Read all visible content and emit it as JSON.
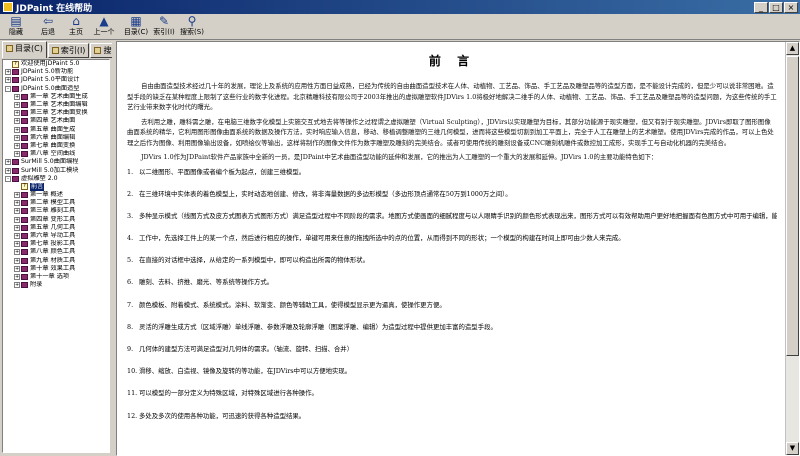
{
  "window": {
    "title": "JDPaint 在线帮助",
    "min": "_",
    "max": "□",
    "close": "×"
  },
  "toolbar": [
    {
      "name": "hide",
      "label": "隐藏",
      "icon": "▤"
    },
    {
      "name": "back",
      "label": "后退",
      "icon": "⇦"
    },
    {
      "name": "home",
      "label": "主页",
      "icon": "⌂"
    },
    {
      "name": "prev",
      "label": "上一个",
      "icon": "▲"
    },
    {
      "name": "toc",
      "label": "目录(C)",
      "icon": "▦"
    },
    {
      "name": "index",
      "label": "索引(I)",
      "icon": "✎"
    },
    {
      "name": "search",
      "label": "搜索(S)",
      "icon": "⚲"
    }
  ],
  "tabs": [
    {
      "label": "目录(C)",
      "active": true
    },
    {
      "label": "索引(I)",
      "active": false
    },
    {
      "label": "搜索(S)",
      "active": false
    }
  ],
  "tree": [
    {
      "indent": 0,
      "exp": "",
      "icon": "q",
      "text": "欢迎使用JDPaint 5.0"
    },
    {
      "indent": 0,
      "exp": "+",
      "icon": "bk",
      "text": "JDPaint 5.0新功能"
    },
    {
      "indent": 0,
      "exp": "+",
      "icon": "bk",
      "text": "JDPaint 5.0平面设计"
    },
    {
      "indent": 0,
      "exp": "-",
      "icon": "bk",
      "text": "JDPaint 5.0曲面造型"
    },
    {
      "indent": 1,
      "exp": "+",
      "icon": "bk",
      "text": "第一章 艺术曲面生成"
    },
    {
      "indent": 1,
      "exp": "+",
      "icon": "bk",
      "text": "第二章 艺术曲面编辑"
    },
    {
      "indent": 1,
      "exp": "+",
      "icon": "bk",
      "text": "第三章 艺术曲面变换"
    },
    {
      "indent": 1,
      "exp": "+",
      "icon": "bk",
      "text": "第四章 艺术曲面"
    },
    {
      "indent": 1,
      "exp": "+",
      "icon": "bk",
      "text": "第五章 曲面生成"
    },
    {
      "indent": 1,
      "exp": "+",
      "icon": "bk",
      "text": "第六章 曲面编辑"
    },
    {
      "indent": 1,
      "exp": "+",
      "icon": "bk",
      "text": "第七章 曲面变换"
    },
    {
      "indent": 1,
      "exp": "+",
      "icon": "bk",
      "text": "第八章 空间曲线"
    },
    {
      "indent": 0,
      "exp": "+",
      "icon": "bk",
      "text": "SurMill 5.0曲面编程"
    },
    {
      "indent": 0,
      "exp": "+",
      "icon": "bk",
      "text": "SurMill 5.0加工模块"
    },
    {
      "indent": 0,
      "exp": "-",
      "icon": "bk",
      "text": "虚拟雕塑 2.0"
    },
    {
      "indent": 1,
      "exp": "",
      "icon": "q",
      "text": "前言",
      "selected": true
    },
    {
      "indent": 1,
      "exp": "+",
      "icon": "bk",
      "text": "第一章 概述"
    },
    {
      "indent": 1,
      "exp": "+",
      "icon": "bk",
      "text": "第二章 模型工具"
    },
    {
      "indent": 1,
      "exp": "+",
      "icon": "bk",
      "text": "第三章 雕刻工具"
    },
    {
      "indent": 1,
      "exp": "+",
      "icon": "bk",
      "text": "第四章 变形工具"
    },
    {
      "indent": 1,
      "exp": "+",
      "icon": "bk",
      "text": "第五章 几何工具"
    },
    {
      "indent": 1,
      "exp": "+",
      "icon": "bk",
      "text": "第六章 导动工具"
    },
    {
      "indent": 1,
      "exp": "+",
      "icon": "bk",
      "text": "第七章 投影工具"
    },
    {
      "indent": 1,
      "exp": "+",
      "icon": "bk",
      "text": "第八章 颜色工具"
    },
    {
      "indent": 1,
      "exp": "+",
      "icon": "bk",
      "text": "第九章 材质工具"
    },
    {
      "indent": 1,
      "exp": "+",
      "icon": "bk",
      "text": "第十章 效果工具"
    },
    {
      "indent": 1,
      "exp": "+",
      "icon": "bk",
      "text": "第十一章 选项"
    },
    {
      "indent": 1,
      "exp": "+",
      "icon": "bk",
      "text": "附录"
    }
  ],
  "doc": {
    "title": "前 言",
    "paragraphs": [
      "自由曲面造型技术经过几十年的发展，理论上及系统的应用性方面日益成熟，已经为传统的自由曲面造型技术在人体、动植物、工艺品、饰品、手工艺品及雕塑品等的造型方面，是不能设计完成的，但是少可以说非常困难。造型手段的缺乏在某种程度上限制了这些行业的数字化进程。北京精雕科技有限公司于2003年推出的虚拟雕塑软件JDVirs 1.0将极好地解决二维手的人体、动植物、工艺品、饰品、手工艺品及雕塑品等的造型问题，为这些传统的手工艺行业带来数字化时代的曙光。",
      "去利用之雕，雕科需之雕，在电脑三维数字化模型上实施交互式地去将等操作之过程谓之虚拟雕塑（Virtual Sculpting），JDVirs以实现雕塑为目标，其部分功能源于现实雕塑，但又有别于现实雕塑。JDVirs即取了图形图像曲面系统的精华，它利用图形图像曲面系统的数据及操作方法，实时响应输入信息，移动、移植调整雕塑的三维几何模型，进而将这些模型切割到加工平面上，完全于人工在雕塑上的艺术雕塑。使用JDVirs完成的作品，可以上色处理之后作为图像、利用图像输出设备，如喷绘仪等输出，这样将制作的图像文件作为数字雕塑及雕刻的完美结合。或者可使用传统的雕刻设备或CNC雕刻机雕件或数控加工成形，实现手工与自动化机器的完美结合。",
      "JDVirs 1.0作为JDPaint软件产品家族中全新的一员，是JDPaint中艺术曲面造型功能的延伸和发展，它的推出为人工雕塑的一个重大的发展和延伸。JDVirs 1.0的主要功能特色如下："
    ],
    "items": [
      "以二维图形、平面图像或者编个板为起点，创建三维模型。",
      "在三维环境中实体表的着色模型上，实时动态地创建、修改，将非海量数据的多边形模型（多边形顶点通常在50万到1000万之间）。",
      "多种显示模式（线图方式及皮方式图表方式图形方式）满足造型过程中不同阶段的需求。地图方式使画面的细腻程度与以人眼睛手识别的颜色形式表现出来，图形方式可以有效帮助用户更好地把握面有色图方式中可用于编辑，能帮助用户方便的理解造型及对地图界面进行各种操作的状态。",
      "工作中，先选择工件上的某一个点，然后进行相应的操作，单键可用来任意的拖拽所选中的点的位置，从而得到不同的形状；一个模型的构建在时间上即可由少数人来完成。",
      "在直接的对话框中选择，从给定的一系列模型中，即可以构造出所需的物体形状。",
      "雕刻、去料、挤推、磨光、等系统等操作方式。",
      "颜色模板、附着模式、系统模式。涂料、软渐变、颜色等辅助工具，使得模型显示更为逼真，使操作更方便。",
      "灵活的浮雕生成方式（区域浮雕）单线浮雕、参数浮雕及轮廓浮雕（图案浮雕、编辑）为造型过程中提供更加丰富的造型手段。",
      "几何体的建型方法可满足造型对几何体的需求。（轴流、旋转、扫描、合并）",
      "滑移、缩放、白造视、镜像及旋转的等功能，在JDVirs中可以方便地实现。",
      "可以模型的一部分定义为特殊区域，对特殊区域进行各种操作。",
      "多处及多次的使用各种功能，可迅速的获得各种造型结果。"
    ]
  }
}
